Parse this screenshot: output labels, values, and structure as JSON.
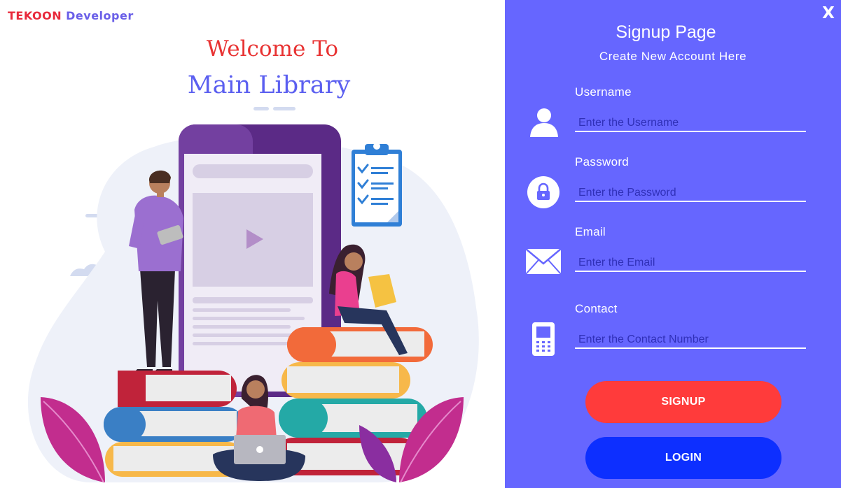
{
  "brand": {
    "name": "TEKOON",
    "suffix": "Developer"
  },
  "welcome": {
    "line1": "Welcome To",
    "line2": "Main Library"
  },
  "form": {
    "close_label": "X",
    "title": "Signup Page",
    "subtitle": "Create New Account Here",
    "fields": [
      {
        "label": "Username",
        "placeholder": "Enter the Username",
        "value": "",
        "icon": "user-icon"
      },
      {
        "label": "Password",
        "placeholder": "Enter the Password",
        "value": "",
        "icon": "lock-icon"
      },
      {
        "label": "Email",
        "placeholder": "Enter the Email",
        "value": "",
        "icon": "envelope-icon"
      },
      {
        "label": "Contact",
        "placeholder": "Enter the Contact Number",
        "value": "",
        "icon": "mobile-phone-icon"
      }
    ],
    "signup_label": "SIGNUP",
    "login_label": "LOGIN"
  },
  "colors": {
    "panel": "#6666ff",
    "signup": "#ff3b3b",
    "login": "#0d2fff",
    "brand_red": "#e8293b",
    "brand_purple": "#6a5fe8",
    "welcome_red": "#e83232",
    "welcome_blue": "#5b5ff0",
    "placeholder": "#3030b8"
  }
}
